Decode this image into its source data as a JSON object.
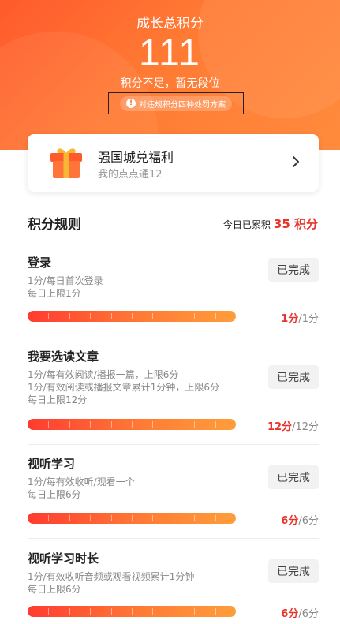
{
  "header": {
    "title": "成长总积分",
    "score": "111",
    "subtitle": "积分不足，暂无段位",
    "notice": "对违规积分四种处罚方案"
  },
  "welfare": {
    "title": "强国城兑福利",
    "subtitle": "我的点点通12",
    "icon": "gift-icon"
  },
  "rules": {
    "title": "积分规则",
    "today_label": "今日已累积",
    "today_value": "35 积分",
    "items": [
      {
        "name": "登录",
        "desc1": "1分/每日首次登录",
        "desc2": "每日上限1分",
        "desc3": "",
        "button": "已完成",
        "got": "1分",
        "total": "/1分",
        "progress": 1.0
      },
      {
        "name": "我要选读文章",
        "desc1": "1分/每有效阅读/播报一篇，上限6分",
        "desc2": "1分/有效阅读或播报文章累计1分钟，上限6分",
        "desc3": "每日上限12分",
        "button": "已完成",
        "got": "12分",
        "total": "/12分",
        "progress": 1.0
      },
      {
        "name": "视听学习",
        "desc1": "1分/每有效收听/观看一个",
        "desc2": "每日上限6分",
        "desc3": "",
        "button": "已完成",
        "got": "6分",
        "total": "/6分",
        "progress": 1.0
      },
      {
        "name": "视听学习时长",
        "desc1": "1分/有效收听音频或观看视频累计1分钟",
        "desc2": "每日上限6分",
        "desc3": "",
        "button": "已完成",
        "got": "6分",
        "total": "/6分",
        "progress": 1.0
      }
    ]
  },
  "colors": {
    "accent": "#ff5a2c",
    "score_red": "#e8332a"
  }
}
